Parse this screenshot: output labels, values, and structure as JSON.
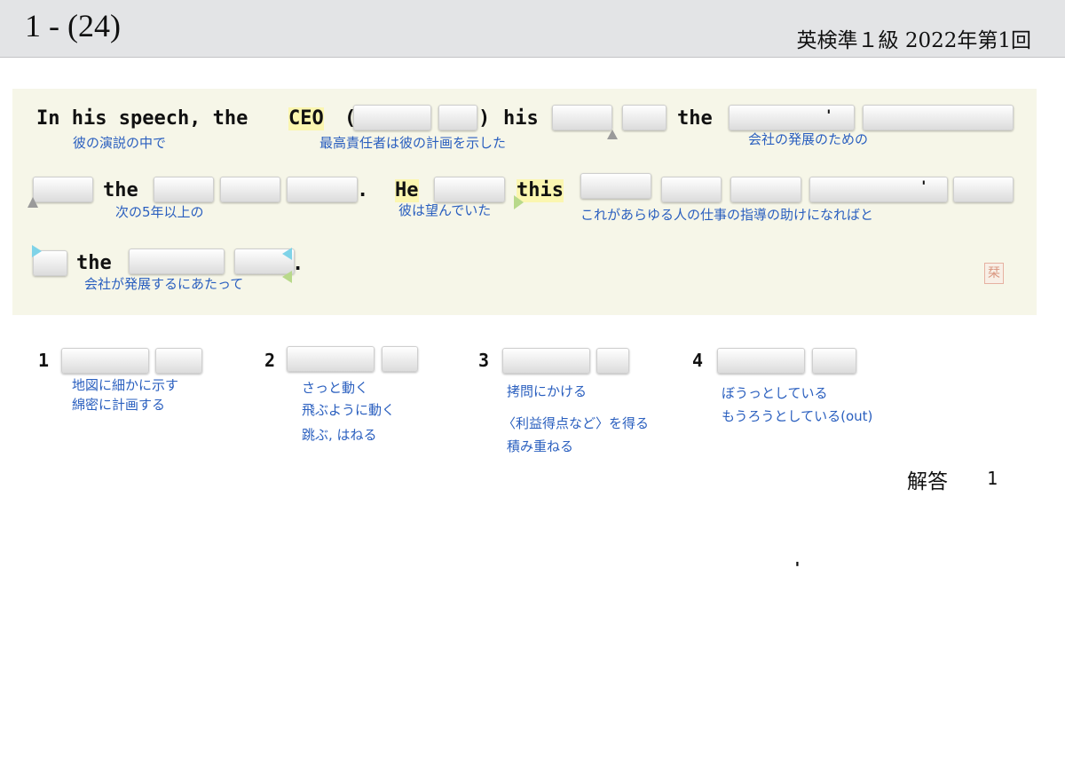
{
  "header": {
    "question_number": "1 - (24)",
    "exam_info": "英検準１級  2022年第1回"
  },
  "sentence": {
    "line1": {
      "w1": "In his speech, the",
      "ceo": "CEO",
      "open_paren": "(",
      "close_paren": ")",
      "his": "his",
      "apos": "'",
      "the": "the"
    },
    "line2": {
      "the": "the",
      "period": ".",
      "he": "He",
      "this": "this",
      "apos": "'"
    },
    "line3": {
      "the": "the",
      "period": "."
    }
  },
  "glosses": {
    "g1": "彼の演説の中で",
    "g2": "最高責任者は彼の計画を示した",
    "g3": "会社の発展のための",
    "g4": "次の5年以上の",
    "g5": "彼は望んでいた",
    "g6": "これがあらゆる人の仕事の指導の助けになればと",
    "g7": "会社が発展するにあたって"
  },
  "choices": [
    {
      "number": "1",
      "glosses": [
        "地図に細かに示す",
        "綿密に計画する"
      ]
    },
    {
      "number": "2",
      "glosses": [
        "さっと動く",
        "飛ぶように動く",
        "跳ぶ, はねる"
      ]
    },
    {
      "number": "3",
      "glosses": [
        "拷問にかける",
        "〈利益得点など〉を得る",
        "積み重ねる"
      ]
    },
    {
      "number": "4",
      "glosses": [
        "ぼうっとしている",
        "もうろうとしている(out)"
      ]
    }
  ],
  "answer": {
    "label": "解答",
    "value": "1"
  },
  "stray_mark": "'",
  "stamp_char": "栞",
  "colors": {
    "gloss": "#2a5fbf",
    "highlight": "#fbf6b0",
    "panel": "#f6f6e8",
    "header": "#e3e4e6"
  }
}
